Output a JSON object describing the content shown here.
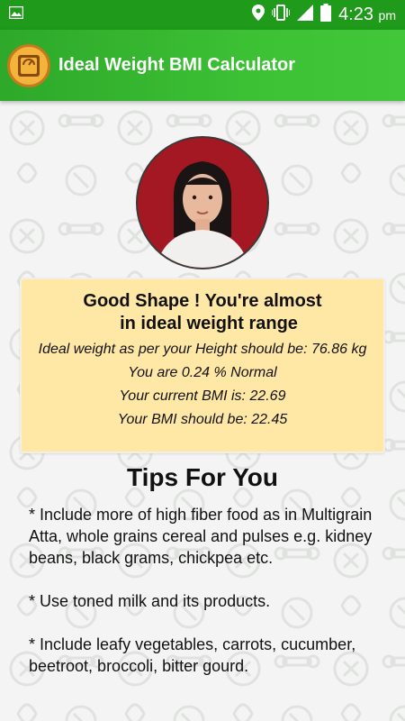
{
  "status_bar": {
    "time": "4:23",
    "ampm": "pm"
  },
  "app_bar": {
    "title": "Ideal Weight BMI Calculator",
    "logo_icon": "weighing-scale-icon"
  },
  "result": {
    "heading_line1": "Good Shape ! You're almost",
    "heading_line2": "in ideal weight range",
    "ideal_weight": "Ideal weight as per your Height should be: 76.86 kg",
    "percent_normal": "You are 0.24 % Normal",
    "current_bmi": "Your current BMI is: 22.69",
    "target_bmi": "Your BMI should be: 22.45"
  },
  "tips": {
    "title": "Tips For You",
    "items": [
      "*  Include more of high fiber food as in Multigrain Atta, whole grains cereal and pulses e.g. kidney beans, black grams, chickpea etc.",
      "*  Use toned milk and its products.",
      "*  Include leafy vegetables, carrots, cucumber, beetroot, broccoli, bitter gourd."
    ]
  },
  "colors": {
    "status_bar": "#1f9a1a",
    "app_bar": "#3cc034",
    "card": "#ffe7a6",
    "avatar_bg": "#a31822"
  }
}
